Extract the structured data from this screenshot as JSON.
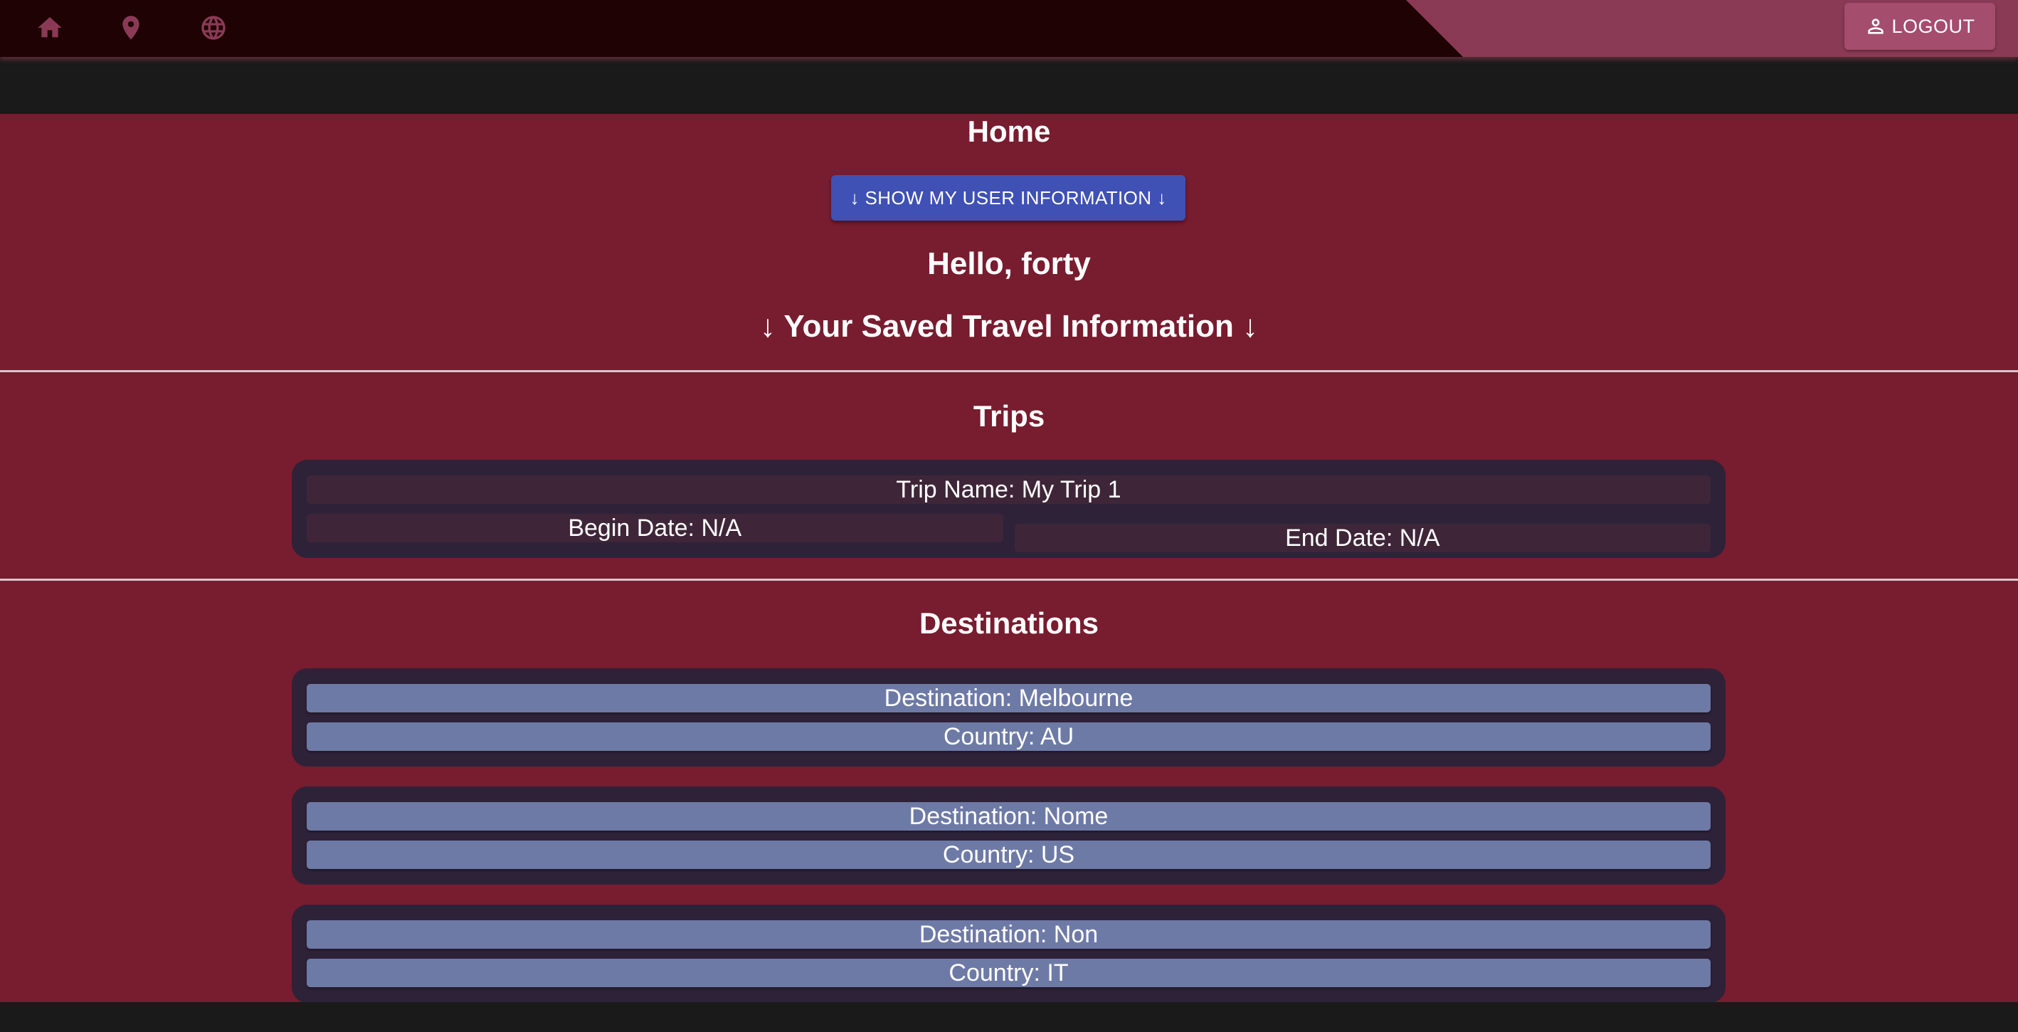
{
  "nav": {
    "icons": [
      "home-icon",
      "place-icon",
      "globe-icon"
    ],
    "logout_label": "LOGOUT",
    "logout_icon": "person-icon"
  },
  "page": {
    "title": "Home",
    "show_info_button": "↓ SHOW MY USER INFORMATION ↓",
    "greeting": "Hello, forty",
    "saved_heading": "↓ Your Saved Travel Information ↓"
  },
  "trips": {
    "title": "Trips",
    "items": [
      {
        "name": "Trip Name: My Trip 1",
        "begin": "Begin Date: N/A",
        "end": "End Date: N/A"
      }
    ]
  },
  "destinations": {
    "title": "Destinations",
    "items": [
      {
        "destination": "Destination: Melbourne",
        "country": "Country: AU"
      },
      {
        "destination": "Destination: Nome",
        "country": "Country: US"
      },
      {
        "destination": "Destination: Non",
        "country": "Country: IT"
      }
    ]
  },
  "colors": {
    "navbar": "#1e0204",
    "accent": "#8b3a55",
    "content_bg": "#781c2f",
    "button": "#3f51b5",
    "card": "#2e2238",
    "dest_field": "#6e7aa6"
  }
}
